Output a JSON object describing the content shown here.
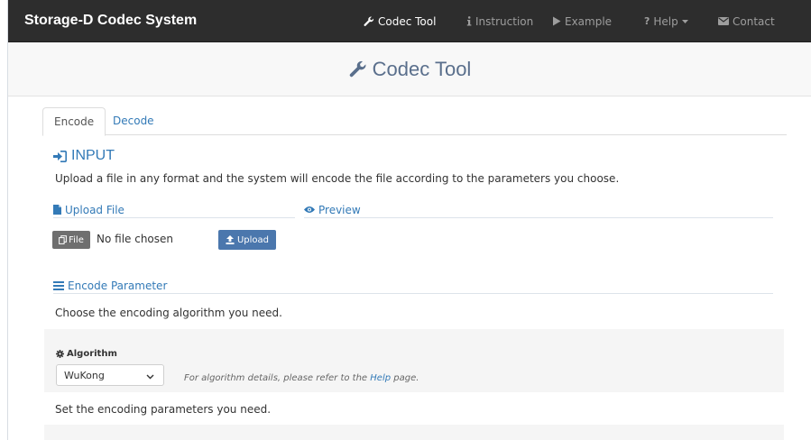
{
  "navbar": {
    "brand": "Storage-D Codec System",
    "items": [
      {
        "label": "Codec Tool",
        "icon": "wrench-icon",
        "active": true
      },
      {
        "label": "Instruction",
        "icon": "info-icon",
        "active": false
      },
      {
        "label": "Example",
        "icon": "play-icon",
        "active": false
      },
      {
        "label": "Help",
        "icon": "question-icon",
        "active": false
      },
      {
        "label": "Contact",
        "icon": "envelope-icon",
        "active": false
      }
    ]
  },
  "header": {
    "title": "Codec Tool"
  },
  "tabs": [
    {
      "label": "Encode",
      "active": true
    },
    {
      "label": "Decode",
      "active": false
    }
  ],
  "input_section": {
    "title": "INPUT",
    "description": "Upload a file in any format and the system will encode the file according to the parameters you choose.",
    "upload_heading": "Upload File",
    "preview_heading": "Preview",
    "file_button": "File",
    "file_status": "No file chosen",
    "upload_button": "Upload"
  },
  "encode_parameter": {
    "heading": "Encode Parameter",
    "description": "Choose the encoding algorithm you need.",
    "algorithm_label": "Algorithm",
    "algorithm_selected": "WuKong",
    "note_prefix": "For algorithm details, please refer to the ",
    "note_link": "Help",
    "note_suffix": " page.",
    "params_description": "Set the encoding parameters you need."
  },
  "colors": {
    "navbar_bg": "#2d2d2d",
    "link": "#337ab7",
    "header_title": "#5a6f8c",
    "upload_button": "#4b77ad",
    "file_button": "#6f6f6f"
  }
}
